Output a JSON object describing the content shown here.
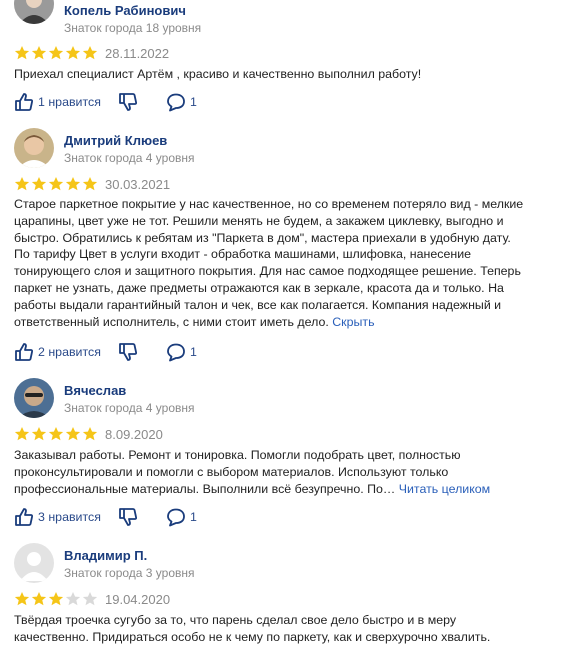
{
  "reviews": [
    {
      "author": "Копель Рабинович",
      "level": "Знаток города 18 уровня",
      "rating": 5,
      "date": "28.11.2022",
      "text": "Приехал специалист Артём , красиво и качественно выполнил работу!",
      "more_label": "",
      "likes_label": "1 нравится",
      "comments": "1",
      "avatar_icon": "avatar-photo-icon"
    },
    {
      "author": "Дмитрий Клюев",
      "level": "Знаток города 4 уровня",
      "rating": 5,
      "date": "30.03.2021",
      "text": "Старое паркетное покрытие у нас качественное, но со временем потеряло вид - мелкие царапины, цвет уже не тот. Решили менять не будем, а закажем циклевку, выгодно и быстро. Обратились к ребятам из \"Паркета в дом\", мастера приехали в удобную дату. По тарифу Цвет в услуги входит - обработка машинами, шлифовка, нанесение тонирующего слоя и защитного покрытия. Для нас самое подходящее решение. Теперь паркет не узнать, даже предметы отражаются как в зеркале, красота да и только. На работы выдали гарантийный талон и чек, все как полагается. Компания надежный и ответственный исполнитель, с ними стоит иметь дело. ",
      "more_label": "Скрыть",
      "likes_label": "2 нравится",
      "comments": "1",
      "avatar_icon": "avatar-photo-icon"
    },
    {
      "author": "Вячеслав",
      "level": "Знаток города 4 уровня",
      "rating": 5,
      "date": "8.09.2020",
      "text": "Заказывал работы. Ремонт и тонировка. Помогли подобрать цвет, полностью проконсультировали и помогли с выбором материалов. Используют только профессиональные материалы. Выполнили всё безупречно. По… ",
      "more_label": "Читать целиком",
      "likes_label": "3 нравится",
      "comments": "1",
      "avatar_icon": "avatar-photo-icon"
    },
    {
      "author": "Владимир П.",
      "level": "Знаток города 3 уровня",
      "rating": 3,
      "date": "19.04.2020",
      "text": "Твёрдая троечка сугубо за то, что парень сделал свое дело быстро и в меру качественно. Придираться особо не к чему по паркету, как и сверхурочно хвалить.",
      "more_label": "",
      "avatar_icon": "avatar-placeholder-icon"
    }
  ],
  "colors": {
    "star_filled": "#f5c518",
    "star_empty": "#d9d9d9",
    "author": "#1a3c7c",
    "link": "#2a5fb9"
  }
}
